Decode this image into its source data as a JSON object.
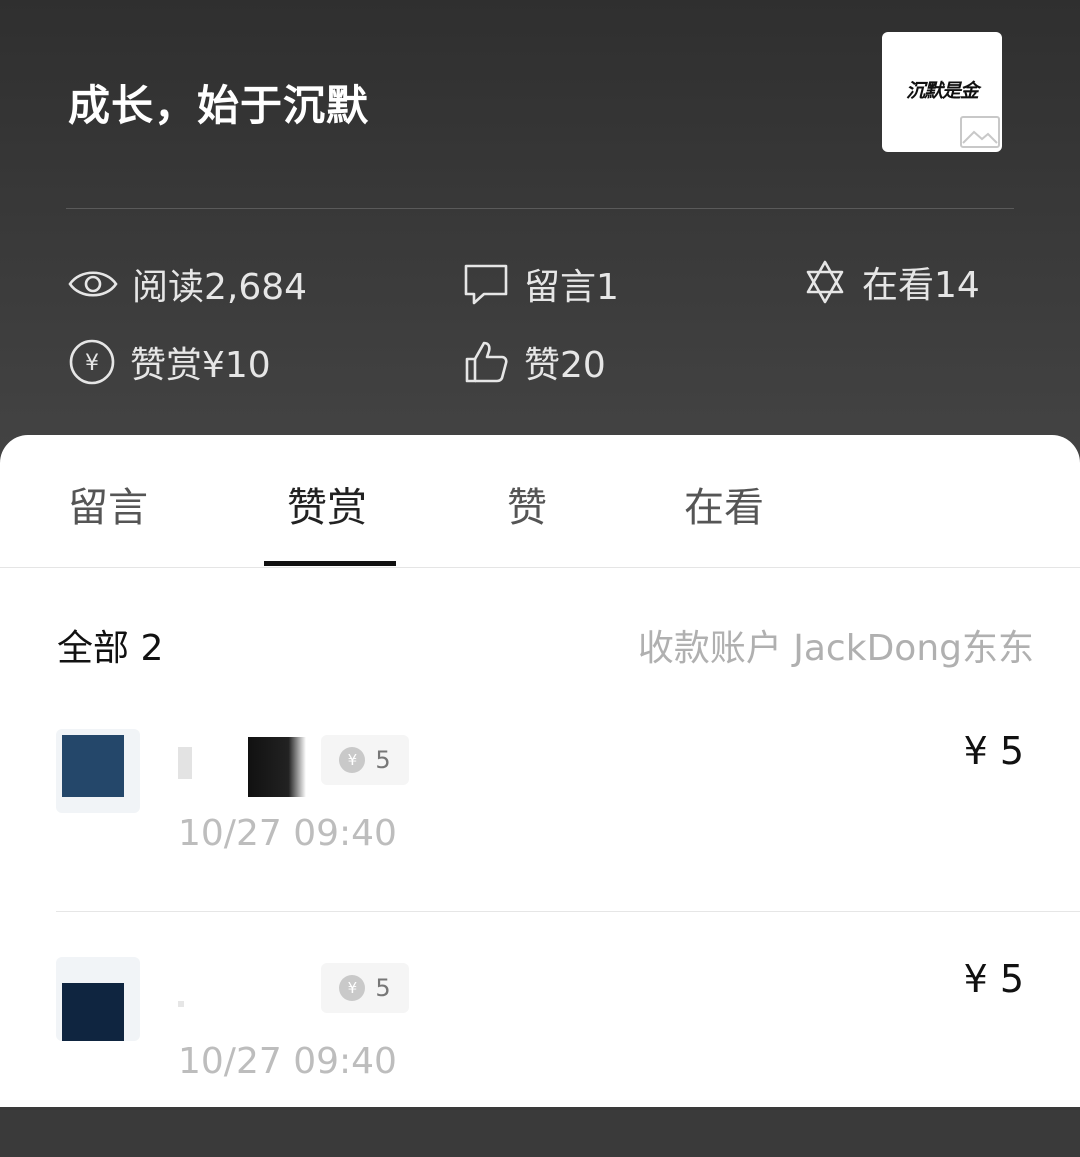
{
  "article": {
    "title": "成长，始于沉默",
    "thumbnail_text": "沉默是金"
  },
  "stats": {
    "reads": "阅读2,684",
    "comments": "留言1",
    "watching": "在看14",
    "rewards": "赞赏¥10",
    "likes": "赞20"
  },
  "tabs": [
    {
      "label": "留言"
    },
    {
      "label": "赞赏",
      "active": true
    },
    {
      "label": "赞"
    },
    {
      "label": "在看"
    }
  ],
  "list": {
    "count_label": "全部 2",
    "account_label": "收款账户 JackDong东东"
  },
  "rewards": [
    {
      "badge": "5",
      "time": "10/27 09:40",
      "amount": "¥ 5",
      "avatar_color": "#24476a"
    },
    {
      "badge": "5",
      "time": "10/27 09:40",
      "amount": "¥ 5",
      "avatar_color": "#0f2540"
    }
  ],
  "icons": {
    "eye": "eye-icon",
    "comment": "comment-bubble-icon",
    "watching": "star-of-david-icon",
    "reward": "yuan-coin-icon",
    "like": "thumbs-up-icon",
    "image_placeholder": "image-icon"
  },
  "colors": {
    "header_bg": "#3a3a3a",
    "active_tab_underline": "#111111",
    "muted_text": "#b0b0b0"
  }
}
